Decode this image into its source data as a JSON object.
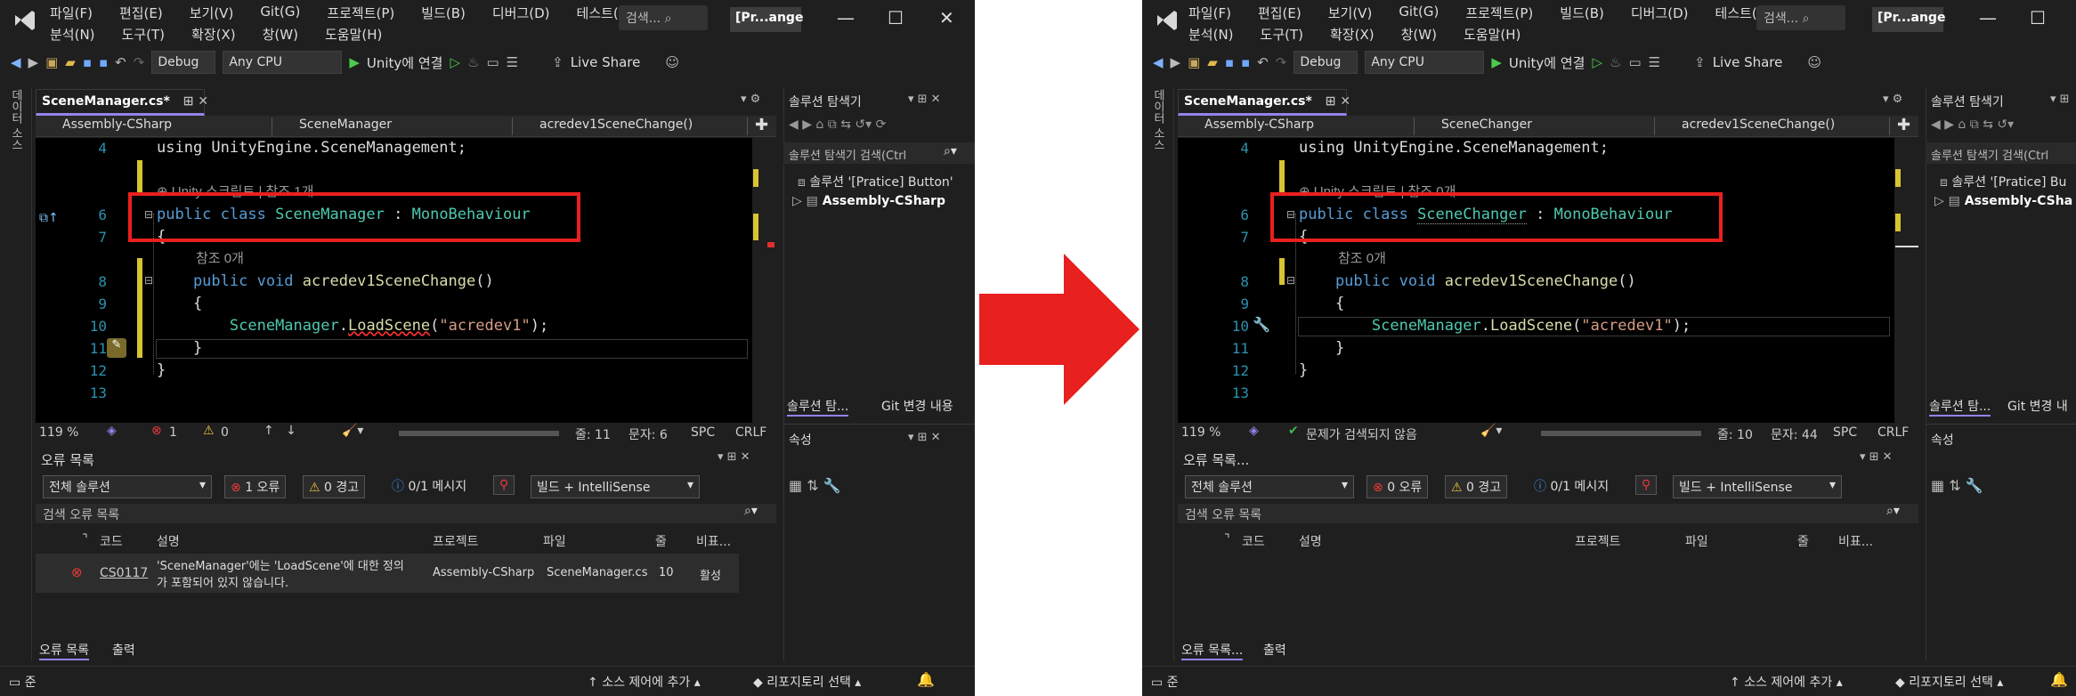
{
  "left": {
    "title_menu_row1": [
      "파일(F)",
      "편집(E)",
      "보기(V)",
      "Git(G)",
      "프로젝트(P)",
      "빌드(B)",
      "디버그(D)",
      "테스트(S)"
    ],
    "title_menu_row2": [
      "분석(N)",
      "도구(T)",
      "확장(X)",
      "창(W)",
      "도움말(H)"
    ],
    "search_placeholder": "검색...",
    "project_badge": "[Pr...ange",
    "toolbar": {
      "config": "Debug",
      "platform": "Any CPU",
      "run_label": "Unity에 연결",
      "live_share": "Live Share"
    },
    "side_label": "데이터 소스",
    "doc_tab": "SceneManager.cs*",
    "nav": {
      "assembly": "Assembly-CSharp",
      "class": "SceneManager",
      "method": "acredev1SceneChange()"
    },
    "code_lines": [
      {
        "num": "4",
        "text": "using UnityEngine.SceneManagement;"
      },
      {
        "lens": "⊕ Unity 스크립트 | 참조 1개"
      },
      {
        "num": "6",
        "kw": "public class ",
        "type": "SceneManager",
        "rest": " : MonoBehaviour"
      },
      {
        "num": "7",
        "text": "{"
      },
      {
        "lens": "참조 0개"
      },
      {
        "num": "8",
        "text": "    public void acredev1SceneChange()"
      },
      {
        "num": "9",
        "text": "    {"
      },
      {
        "num": "10",
        "text": "        SceneManager.LoadScene(\"acredev1\");"
      },
      {
        "num": "11",
        "text": "    }"
      },
      {
        "num": "12",
        "text": "}"
      },
      {
        "num": "13",
        "text": ""
      }
    ],
    "status": {
      "zoom": "119 %",
      "errors": "1",
      "warnings": "0",
      "line": "줄: 11",
      "char": "문자: 6",
      "spc": "SPC",
      "crlf": "CRLF"
    },
    "error_panel": {
      "title": "오류 목록",
      "scope": "전체 솔루션",
      "err_btn": "1 오류",
      "warn_btn": "0 경고",
      "msg_btn": "0/1 메시지",
      "build_filter": "빌드 + IntelliSense",
      "search": "검색 오류 목록",
      "columns": [
        "코드",
        "설명",
        "프로젝트",
        "파일",
        "줄",
        "비표..."
      ],
      "row": {
        "code": "CS0117",
        "desc1": "'SceneManager'에는 'LoadScene'에 대한 정의",
        "desc2": "가 포함되어 있지 않습니다.",
        "project": "Assembly-CSharp",
        "file": "SceneManager.cs",
        "line": "10",
        "state": "활성"
      },
      "tabs": [
        "오류 목록",
        "출력"
      ]
    },
    "solution": {
      "title": "솔루션 탐색기",
      "search": "솔루션 탐색기 검색(Ctrl",
      "item1": "솔루션 '[Pratice] Button'",
      "item2": "Assembly-CSharp",
      "tab1": "솔루션 탐...",
      "tab2": "Git 변경 내용"
    },
    "properties": {
      "title": "속성"
    },
    "statusbar": {
      "ready": "준",
      "source": "소스 제어에 추가",
      "repo": "리포지토리 선택"
    }
  },
  "right": {
    "title_menu_row1": [
      "파일(F)",
      "편집(E)",
      "보기(V)",
      "Git(G)",
      "프로젝트(P)",
      "빌드(B)",
      "디버그(D)",
      "테스트(S)"
    ],
    "title_menu_row2": [
      "분석(N)",
      "도구(T)",
      "확장(X)",
      "창(W)",
      "도움말(H)"
    ],
    "search_placeholder": "검색...",
    "project_badge": "[Pr...ange",
    "toolbar": {
      "config": "Debug",
      "platform": "Any CPU",
      "run_label": "Unity에 연결",
      "live_share": "Live Share"
    },
    "side_label": "데이터 소스",
    "doc_tab": "SceneManager.cs*",
    "nav": {
      "assembly": "Assembly-CSharp",
      "class": "SceneChanger",
      "method": "acredev1SceneChange()"
    },
    "code_lines": [
      {
        "num": "4",
        "text": "using UnityEngine.SceneManagement;"
      },
      {
        "lens": "⊕ Unity 스크립트 | 참조 0개"
      },
      {
        "num": "6",
        "kw": "public class ",
        "type": "SceneChanger",
        "rest": " : MonoBehaviour"
      },
      {
        "num": "7",
        "text": "{"
      },
      {
        "lens": "참조 0개"
      },
      {
        "num": "8",
        "text": "    public void acredev1SceneChange()"
      },
      {
        "num": "9",
        "text": "    {"
      },
      {
        "num": "10",
        "text": "        SceneManager.LoadScene(\"acredev1\");"
      },
      {
        "num": "11",
        "text": "    }"
      },
      {
        "num": "12",
        "text": "}"
      },
      {
        "num": "13",
        "text": ""
      }
    ],
    "status": {
      "zoom": "119 %",
      "no_issues": "문제가 검색되지 않음",
      "line": "줄: 10",
      "char": "문자: 44",
      "spc": "SPC",
      "crlf": "CRLF"
    },
    "error_panel": {
      "title": "오류 목록...",
      "scope": "전체 솔루션",
      "err_btn": "0 오류",
      "warn_btn": "0 경고",
      "msg_btn": "0/1 메시지",
      "build_filter": "빌드 + IntelliSense",
      "search": "검색 오류 목록",
      "columns": [
        "코드",
        "설명",
        "프로젝트",
        "파일",
        "줄",
        "비표..."
      ],
      "tabs": [
        "오류 목록...",
        "출력"
      ]
    },
    "solution": {
      "title": "솔루션 탐색기",
      "search": "솔루션 탐색기 검색(Ctrl",
      "item1": "솔루션 '[Pratice] Bu",
      "item2": "Assembly-CShar",
      "tab1": "솔루션 탐...",
      "tab2": "Git 변경 내"
    },
    "properties": {
      "title": "속성"
    },
    "statusbar": {
      "ready": "준",
      "source": "소스 제어에 추가",
      "repo": "리포지토리 선택"
    }
  },
  "colors": {
    "highlight_box": "#e8201f",
    "arrow": "#e8201f",
    "accent": "#9184ee"
  }
}
